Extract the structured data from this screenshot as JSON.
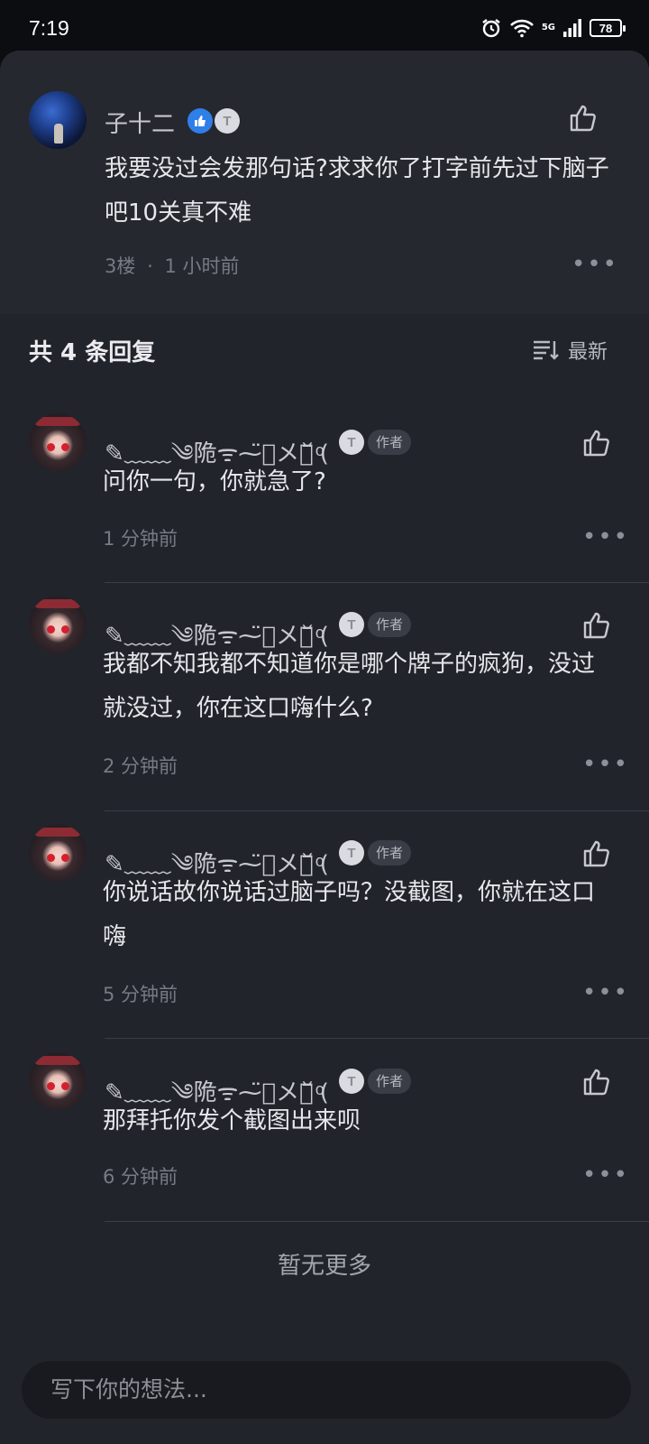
{
  "status_bar": {
    "time": "7:19",
    "network": "5G",
    "battery": "78"
  },
  "main_comment": {
    "username": "子十二",
    "level_badge": "T",
    "text": "我要没过会发那句话?求求你了打字前先过下脑子吧10关真不难",
    "floor": "3楼",
    "separator": "·",
    "time": "1 小时前"
  },
  "replies_header": {
    "title": "共 4 条回复",
    "sort_label": "最新"
  },
  "replies": [
    {
      "username": "✎﹏﹏༄陒ᯤ⁓̈⃝メ药᷄᷅ ͦ(",
      "level_badge": "T",
      "tag": "作者",
      "text": "问你一句，你就急了?",
      "time": "1 分钟前"
    },
    {
      "username": "✎﹏﹏༄陒ᯤ⁓̈⃝メ药᷄᷅ ͦ(",
      "level_badge": "T",
      "tag": "作者",
      "text": "我都不知我都不知道你是哪个牌子的疯狗，没过就没过，你在这口嗨什么?",
      "time": "2 分钟前"
    },
    {
      "username": "✎﹏﹏༄陒ᯤ⁓̈⃝メ药᷄᷅ ͦ(",
      "level_badge": "T",
      "tag": "作者",
      "text": "你说话故你说话过脑子吗？没截图，你就在这口嗨",
      "time": "5 分钟前"
    },
    {
      "username": "✎﹏﹏༄陒ᯤ⁓̈⃝メ药᷄᷅ ͦ(",
      "level_badge": "T",
      "tag": "作者",
      "text": "那拜托你发个截图出来呗",
      "time": "6 分钟前"
    }
  ],
  "footer": {
    "no_more": "暂无更多",
    "input_placeholder": "写下你的想法..."
  },
  "colors": {
    "sheet_bg": "#22242c",
    "main_comment_bg": "#26282f",
    "accent_blue": "#2f7fe8"
  }
}
